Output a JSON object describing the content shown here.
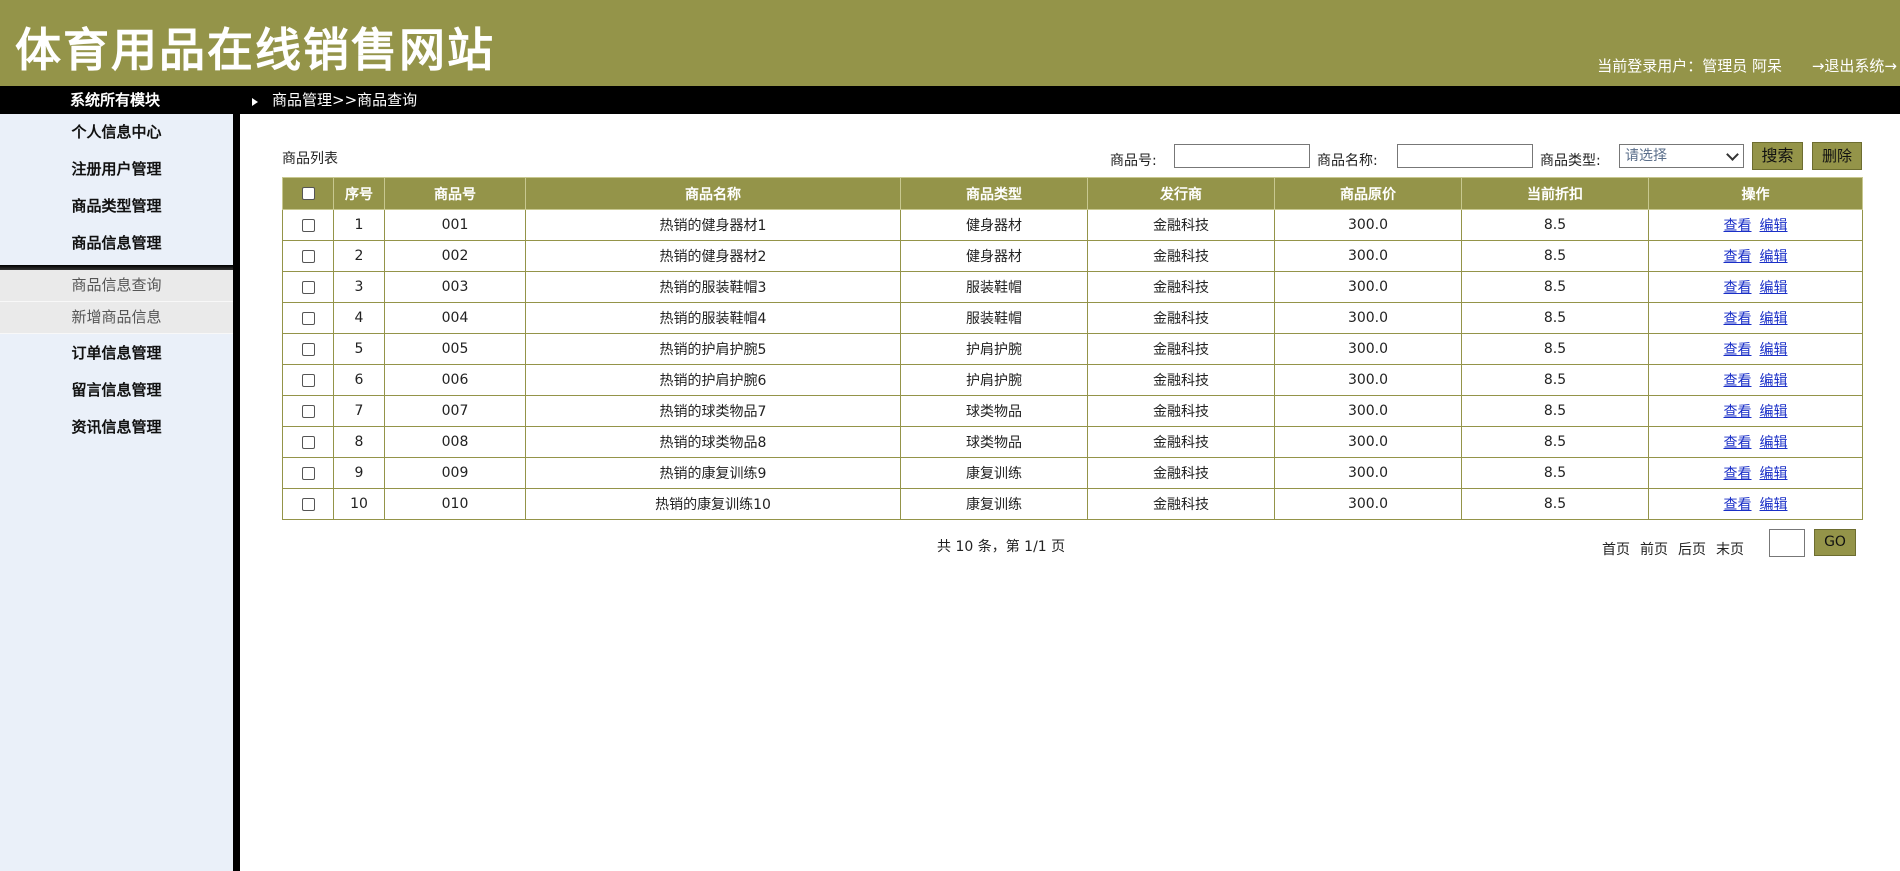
{
  "header": {
    "site_title": "体育用品在线销售网站",
    "user_info": "当前登录用户：管理员 阿呆",
    "logout": "→退出系统→"
  },
  "topbar": {
    "sidebar_title": "系统所有模块",
    "breadcrumb": "商品管理>>商品查询"
  },
  "sidebar": {
    "items": [
      {
        "label": "个人信息中心"
      },
      {
        "label": "注册用户管理"
      },
      {
        "label": "商品类型管理"
      },
      {
        "label": "商品信息管理"
      },
      {
        "label": "订单信息管理"
      },
      {
        "label": "留言信息管理"
      },
      {
        "label": "资讯信息管理"
      }
    ],
    "subitems": [
      {
        "label": "商品信息查询"
      },
      {
        "label": "新增商品信息"
      }
    ]
  },
  "content": {
    "list_title": "商品列表",
    "search": {
      "id_label": "商品号:",
      "id_value": "",
      "name_label": "商品名称:",
      "name_value": "",
      "type_label": "商品类型:",
      "type_selected": "请选择",
      "search_button": "搜索",
      "delete_button": "删除"
    },
    "table": {
      "headers": [
        "",
        "序号",
        "商品号",
        "商品名称",
        "商品类型",
        "发行商",
        "商品原价",
        "当前折扣",
        "操作"
      ],
      "rows": [
        {
          "seq": "1",
          "code": "001",
          "name": "热销的健身器材1",
          "type": "健身器材",
          "publisher": "金融科技",
          "price": "300.0",
          "discount": "8.5"
        },
        {
          "seq": "2",
          "code": "002",
          "name": "热销的健身器材2",
          "type": "健身器材",
          "publisher": "金融科技",
          "price": "300.0",
          "discount": "8.5"
        },
        {
          "seq": "3",
          "code": "003",
          "name": "热销的服装鞋帽3",
          "type": "服装鞋帽",
          "publisher": "金融科技",
          "price": "300.0",
          "discount": "8.5"
        },
        {
          "seq": "4",
          "code": "004",
          "name": "热销的服装鞋帽4",
          "type": "服装鞋帽",
          "publisher": "金融科技",
          "price": "300.0",
          "discount": "8.5"
        },
        {
          "seq": "5",
          "code": "005",
          "name": "热销的护肩护腕5",
          "type": "护肩护腕",
          "publisher": "金融科技",
          "price": "300.0",
          "discount": "8.5"
        },
        {
          "seq": "6",
          "code": "006",
          "name": "热销的护肩护腕6",
          "type": "护肩护腕",
          "publisher": "金融科技",
          "price": "300.0",
          "discount": "8.5"
        },
        {
          "seq": "7",
          "code": "007",
          "name": "热销的球类物品7",
          "type": "球类物品",
          "publisher": "金融科技",
          "price": "300.0",
          "discount": "8.5"
        },
        {
          "seq": "8",
          "code": "008",
          "name": "热销的球类物品8",
          "type": "球类物品",
          "publisher": "金融科技",
          "price": "300.0",
          "discount": "8.5"
        },
        {
          "seq": "9",
          "code": "009",
          "name": "热销的康复训练9",
          "type": "康复训练",
          "publisher": "金融科技",
          "price": "300.0",
          "discount": "8.5"
        },
        {
          "seq": "10",
          "code": "010",
          "name": "热销的康复训练10",
          "type": "康复训练",
          "publisher": "金融科技",
          "price": "300.0",
          "discount": "8.5"
        }
      ],
      "view_label": "查看",
      "edit_label": "编辑"
    },
    "pagination": {
      "summary": "共 10 条，第 1/1 页",
      "first": "首页",
      "prev": "前页",
      "next": "后页",
      "last": "末页",
      "page_value": "",
      "go_label": "GO"
    }
  },
  "colors": {
    "brand": "#949449",
    "sidebar_bg": "#eaf0f9",
    "link": "#1a2fc7"
  }
}
